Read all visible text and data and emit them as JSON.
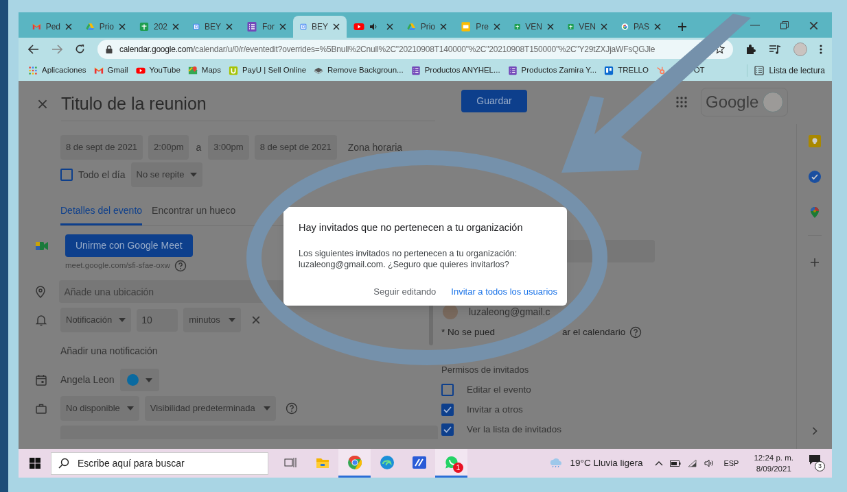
{
  "tabs": [
    {
      "kind": "gmail",
      "label": "Ped",
      "selected": false
    },
    {
      "kind": "drive",
      "label": "Prio",
      "selected": false
    },
    {
      "kind": "sheets",
      "label": "202",
      "selected": false
    },
    {
      "kind": "calendar",
      "label": "BEY",
      "selected": false
    },
    {
      "kind": "forms",
      "label": "For",
      "selected": false
    },
    {
      "kind": "calendar",
      "label": "BEY",
      "selected": true
    },
    {
      "kind": "youtube",
      "selected": false,
      "audio": true
    },
    {
      "kind": "drive",
      "label": "Prio",
      "selected": false
    },
    {
      "kind": "slides",
      "label": "Pre",
      "selected": false
    },
    {
      "kind": "sheets",
      "label": "VEN",
      "selected": false
    },
    {
      "kind": "sheets",
      "label": "VEN",
      "selected": false
    },
    {
      "kind": "google",
      "label": "PAS",
      "selected": false
    }
  ],
  "address": {
    "domain": "calendar.google.com",
    "path": "/calendar/u/0/r/eventedit?overrides=%5Bnull%2Cnull%2C\"20210908T140000\"%2C\"20210908T150000\"%2C\"Y29tZXJjaWFsQGJle"
  },
  "bookmarks": [
    {
      "kind": "apps",
      "label": "Aplicaciones"
    },
    {
      "kind": "gmail",
      "label": "Gmail"
    },
    {
      "kind": "youtube",
      "label": "YouTube"
    },
    {
      "kind": "maps",
      "label": "Maps"
    },
    {
      "kind": "payu",
      "label": "PayU | Sell Online"
    },
    {
      "kind": "layers",
      "label": "Remove Backgroun..."
    },
    {
      "kind": "forms",
      "label": "Productos ANYHEL..."
    },
    {
      "kind": "forms",
      "label": "Productos Zamira Y..."
    },
    {
      "kind": "trello",
      "label": "TRELLO"
    },
    {
      "kind": "hubspot",
      "label": "OT"
    }
  ],
  "reading_list": "Lista de lectura",
  "event": {
    "title": "Titulo de la reunion",
    "save_button": "Guardar",
    "account_label": "Google",
    "start_date": "8 de sept de 2021",
    "start_time": "2:00pm",
    "to": "a",
    "end_time": "3:00pm",
    "end_date": "8 de sept de 2021",
    "timezone": "Zona horaria",
    "all_day": {
      "label": "Todo el día",
      "checked": false
    },
    "repeat": "No se repite",
    "tabs": [
      {
        "label": "Detalles del evento",
        "selected": true
      },
      {
        "label": "Encontrar un hueco",
        "selected": false
      }
    ],
    "meet_button": "Unirme con Google Meet",
    "meet_link": "meet.google.com/sfi-sfae-oxw",
    "location_placeholder": "Añade una ubicación",
    "notification": {
      "type": "Notificación",
      "value": "10",
      "unit": "minutos"
    },
    "add_notification": "Añadir una notificación",
    "calendar": {
      "owner": "Angela Leon",
      "color": "#0a6aa0"
    },
    "availability": "No disponible",
    "visibility": "Visibilidad predeterminada"
  },
  "guests": {
    "guest": "luzaleong@gmail.c",
    "note_start": "* No se pued",
    "note_end": "ar el calendario",
    "permissions_title": "Permisos de invitados",
    "permissions": [
      {
        "label": "Editar el evento",
        "checked": false
      },
      {
        "label": "Invitar a otros",
        "checked": true
      },
      {
        "label": "Ver la lista de invitados",
        "checked": true
      }
    ]
  },
  "dialog": {
    "title": "Hay invitados que no pertenecen a tu organización",
    "body": "Los siguientes invitados no pertenecen a tu organización: luzaleong@gmail.com. ¿Seguro que quieres invitarlos?",
    "buttons": [
      {
        "label": "Seguir editando",
        "kind": "secondary"
      },
      {
        "label": "Invitar a todos los usuarios",
        "kind": "primary"
      }
    ]
  },
  "taskbar": {
    "search_placeholder": "Escribe aquí para buscar",
    "apps": [
      {
        "kind": "taskview",
        "open": false
      },
      {
        "kind": "folder",
        "open": false
      },
      {
        "kind": "chrome",
        "open": true
      },
      {
        "kind": "edge",
        "open": false
      },
      {
        "kind": "mail-app",
        "open": false
      },
      {
        "kind": "whatsapp",
        "open": true,
        "badge": "1"
      }
    ],
    "weather": "19°C Lluvia ligera",
    "language": "ESP",
    "time": "12:24 p. m.",
    "date": "8/09/2021",
    "notifications": "3"
  }
}
